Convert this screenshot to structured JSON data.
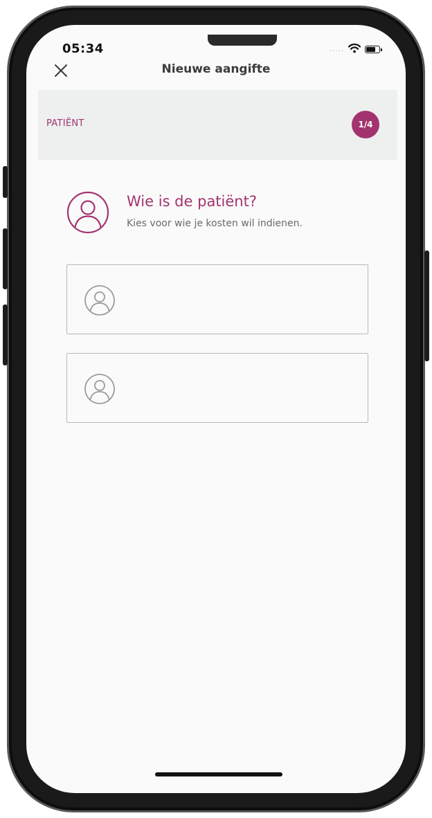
{
  "status_bar": {
    "time": "05:34",
    "signal": "....."
  },
  "nav": {
    "title": "Nieuwe aangifte",
    "close_icon": "close-icon"
  },
  "step": {
    "label": "PATIËNT",
    "progress": "1/4",
    "current": 1,
    "total": 4
  },
  "question": {
    "icon": "person-icon",
    "title": "Wie is de patiënt?",
    "subtitle": "Kies voor wie je kosten wil indienen."
  },
  "patients": [
    {
      "icon": "person-icon",
      "name": ""
    },
    {
      "icon": "person-icon",
      "name": ""
    }
  ],
  "colors": {
    "accent": "#a3336f",
    "header_background": "#eef0f0",
    "screen_background": "#fafafa",
    "border": "#b9b9b9"
  }
}
